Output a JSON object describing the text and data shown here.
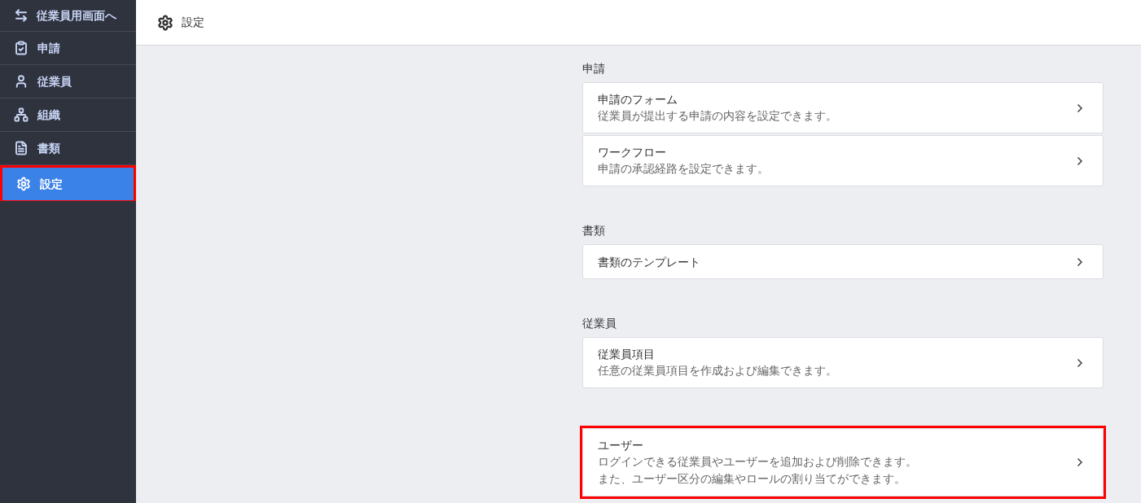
{
  "switch_link": {
    "label": "従業員用画面へ"
  },
  "sidebar": {
    "items": [
      {
        "label": "申請",
        "selected": false,
        "highlighted": false
      },
      {
        "label": "従業員",
        "selected": false,
        "highlighted": false
      },
      {
        "label": "組織",
        "selected": false,
        "highlighted": false
      },
      {
        "label": "書類",
        "selected": false,
        "highlighted": false
      },
      {
        "label": "設定",
        "selected": true,
        "highlighted": true
      }
    ]
  },
  "header": {
    "title": "設定"
  },
  "sections": [
    {
      "heading": "申請",
      "cards": [
        {
          "title": "申請のフォーム",
          "description": [
            "従業員が提出する申請の内容を設定できます。"
          ],
          "highlighted": false
        },
        {
          "title": "ワークフロー",
          "description": [
            "申請の承認経路を設定できます。"
          ],
          "highlighted": false
        }
      ]
    },
    {
      "heading": "書類",
      "cards": [
        {
          "title": "書類のテンプレート",
          "highlighted": false
        }
      ]
    },
    {
      "heading": "従業員",
      "cards": [
        {
          "title": "従業員項目",
          "description": [
            "任意の従業員項目を作成および編集できます。"
          ],
          "highlighted": false
        }
      ]
    },
    {
      "cards": [
        {
          "title": "ユーザー",
          "description": [
            "ログインできる従業員やユーザーを追加および削除できます。",
            "また、ユーザー区分の編集やロールの割り当てができます。"
          ],
          "highlighted": true
        }
      ]
    }
  ]
}
